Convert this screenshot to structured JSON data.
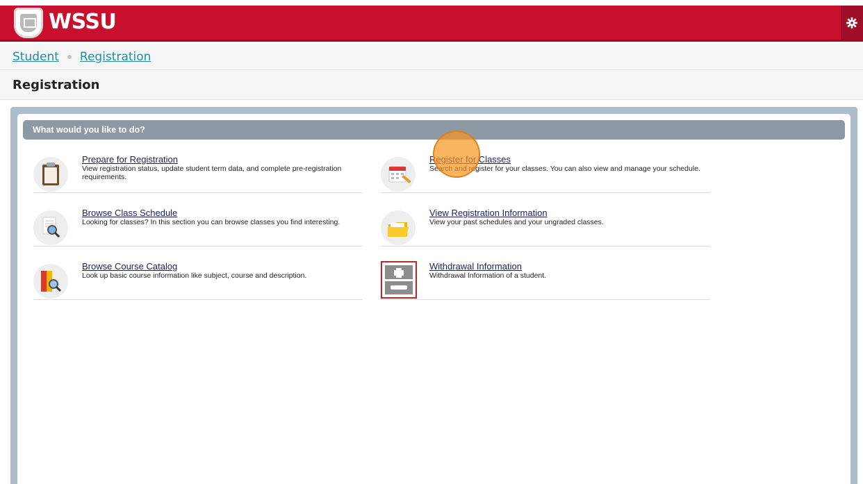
{
  "header": {
    "logo_text": "WSSU",
    "brand_color": "#c8102e",
    "settings_icon": "gear-icon"
  },
  "breadcrumb": {
    "items": [
      "Student",
      "Registration"
    ]
  },
  "page": {
    "title": "Registration"
  },
  "panel": {
    "header": "What would you like to do?",
    "items": [
      {
        "title": "Prepare for Registration",
        "description": "View registration status, update student term data, and complete pre-registration requirements.",
        "icon": "clipboard-icon"
      },
      {
        "title": "Register for Classes",
        "description": "Search and register for your classes. You can also view and manage your schedule.",
        "icon": "calendar-pencil-icon"
      },
      {
        "title": "Browse Class Schedule",
        "description": "Looking for classes? In this section you can browse classes you find interesting.",
        "icon": "document-search-icon"
      },
      {
        "title": "View Registration Information",
        "description": "View your past schedules and your ungraded classes.",
        "icon": "folder-icon"
      },
      {
        "title": "Browse Course Catalog",
        "description": "Look up basic course information like subject, course and description.",
        "icon": "book-search-icon"
      },
      {
        "title": "Withdrawal Information",
        "description": "Withdrawal Information of a student.",
        "icon": "plus-minus-icon"
      }
    ]
  }
}
